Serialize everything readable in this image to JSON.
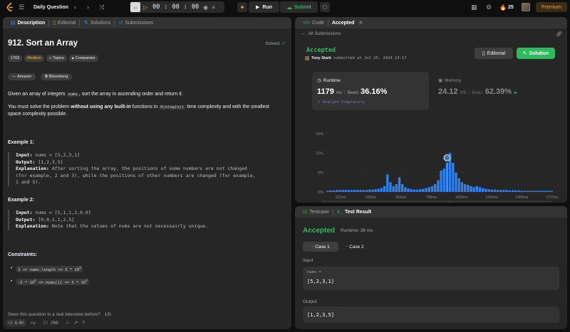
{
  "topbar": {
    "problem_list_label": "Daily Question",
    "timer": {
      "h": "00",
      "sep1": ":",
      "m": "00",
      "sep2": ":",
      "s": "00"
    },
    "run_label": "Run",
    "submit_label": "Submit",
    "streak_count": "25",
    "premium_label": "Premium"
  },
  "left": {
    "tabs": [
      "Description",
      "Editorial",
      "Solutions",
      "Submissions"
    ],
    "title": "912. Sort an Array",
    "solved_label": "Solved",
    "likes_count_badge": "1762",
    "difficulty": "Medium",
    "topics_label": "Topics",
    "companies_label": "Companies",
    "company_tags": [
      "Amazon",
      "Bloomberg"
    ],
    "desc_1a": "Given an array of integers",
    "desc_1_code": "nums",
    "desc_1b": ", sort the array in ascending order and return it.",
    "desc_2a": "You must solve the problem",
    "desc_2_bold": "without using any built-in",
    "desc_2b": "functions in",
    "desc_2_code": "O(nlog(n))",
    "desc_2c": "time complexity and with the smallest",
    "desc_2d": "space complexity possible.",
    "example1": {
      "title": "Example 1:",
      "input_label": "Input:",
      "input": "nums = [5,2,3,1]",
      "output_label": "Output:",
      "output": "[1,2,3,5]",
      "expl_label": "Explanation:",
      "expl_1": "After sorting the array, the positions of some numbers are not changed",
      "expl_2": "(for example, 2 and 3), while the positions of other numbers are changed (for example,",
      "expl_3": "1 and 5)."
    },
    "example2": {
      "title": "Example 2:",
      "input_label": "Input:",
      "input": "nums = [5,1,1,2,0,0]",
      "output_label": "Output:",
      "output": "[0,0,1,1,2,5]",
      "expl_label": "Explanation:",
      "expl_1": "Note that the values of nums are not necessairly unique."
    },
    "constraints_title": "Constraints:",
    "constraint_1": "1 <= nums.length <= 5 * 10",
    "constraint_1_sup": "4",
    "constraint_2a": "-5 * 10",
    "constraint_2_sup1": "4",
    "constraint_2b": " <= nums[i] <= 5 * 10",
    "constraint_2_sup2": "4",
    "interview_prompt": "Seen this question in a real interview before?",
    "interview_count": "1/5",
    "footer_likes": "6.4K",
    "footer_comments": "268"
  },
  "right_top": {
    "tab_code": "Code",
    "tab_accepted": "Accepted",
    "all_submissions": "All Submissions",
    "status": "Accepted",
    "user": "Tony Stark",
    "submitted_at": "submitted at Jul 25, 2024 23:17",
    "editorial_btn": "Editorial",
    "solution_btn": "Solution",
    "runtime_label": "Runtime",
    "runtime_value": "1179",
    "runtime_unit": "ms",
    "beats_label": "Beats",
    "runtime_beats": "36.16%",
    "analyze_label": "Analyze Complexity",
    "memory_label": "Memory",
    "memory_value": "24.12",
    "memory_unit": "MB",
    "memory_beats": "62.39%"
  },
  "chart_data": {
    "type": "bar",
    "y_ticks": [
      "15%",
      "10%",
      "5%",
      "0%"
    ],
    "ylim": [
      0,
      15
    ],
    "x_ticks": [
      "101ms",
      "333ms",
      "566ms",
      "798ms",
      "1030ms",
      "1262ms",
      "1495ms",
      "1727ms"
    ],
    "mini_x_ticks": [
      "101ms",
      "333ms",
      "566ms",
      "798ms",
      "1030ms",
      "1262ms",
      "1495ms",
      "1727ms"
    ],
    "values": [
      0.3,
      0.4,
      0.4,
      0.5,
      0.5,
      0.5,
      0.5,
      0.5,
      0.5,
      0.5,
      0.5,
      0.5,
      0.5,
      0.5,
      0.6,
      0.6,
      0.7,
      0.8,
      1.0,
      1.5,
      4.5,
      2.5,
      1.5,
      2.0,
      3.8,
      2.0,
      1.2,
      0.9,
      0.7,
      0.6,
      0.6,
      0.7,
      0.8,
      1.0,
      1.2,
      1.5,
      2.0,
      3.0,
      5.5,
      6.0,
      7.5,
      10.0,
      7.5,
      5.0,
      3.5,
      2.5,
      2.0,
      1.8,
      1.5,
      1.2,
      1.5,
      1.2,
      1.0,
      0.8,
      0.7,
      0.6,
      0.6,
      0.5,
      0.5,
      0.5,
      0.5,
      0.4,
      0.4,
      0.4,
      0.4,
      0.3,
      0.3,
      0.3,
      0.3,
      0.3,
      0.3,
      0.3,
      0.3,
      0.3,
      0.3,
      0.3
    ],
    "highlight_index": 40
  },
  "right_bottom": {
    "tab_testcase": "Testcase",
    "tab_result": "Test Result",
    "status": "Accepted",
    "runtime": "Runtime: 36 ms",
    "case1": "Case 1",
    "case2": "Case 2",
    "input_label": "Input",
    "input_var": "nums =",
    "input_value": "[5,2,3,1]",
    "output_label": "Output",
    "output_value": "[1,2,3,5]"
  },
  "colors": {
    "accent_green": "#2cbb5d",
    "accepted_green": "#2db55d",
    "medium_yellow": "#ffc01e",
    "bar_blue": "#2f80ed",
    "premium": "#ffa116"
  }
}
